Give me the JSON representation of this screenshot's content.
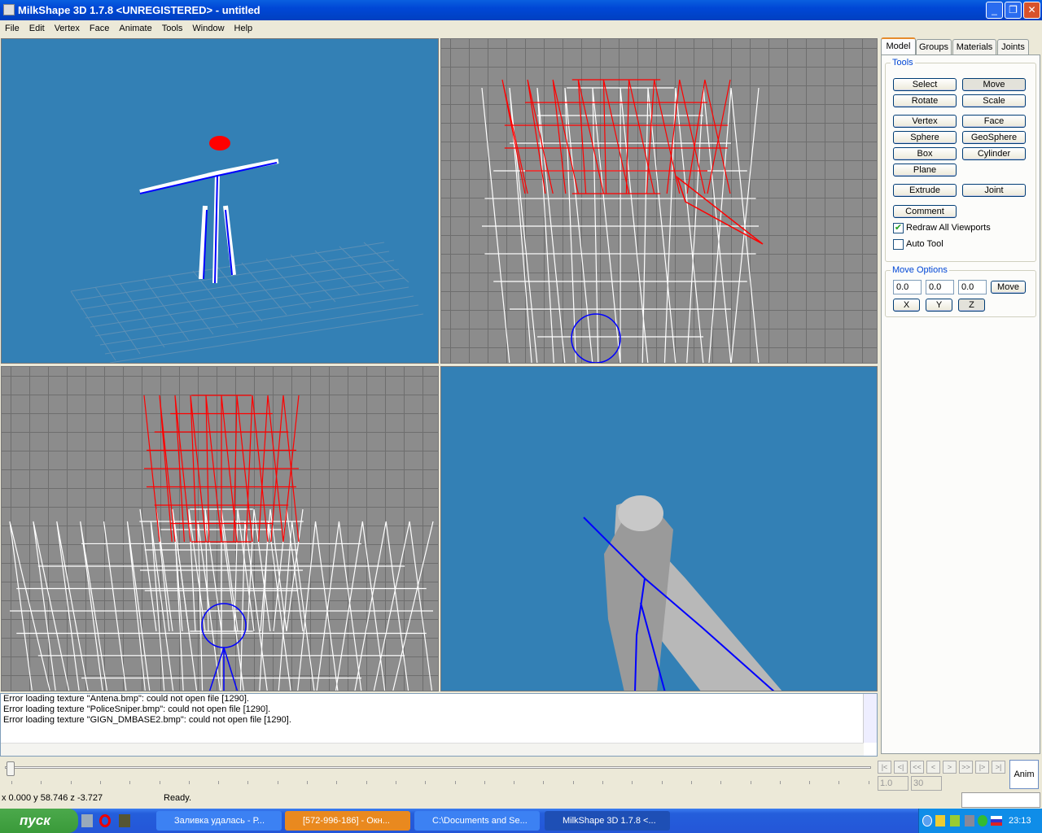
{
  "window": {
    "title": "MilkShape 3D 1.7.8 <UNREGISTERED> - untitled",
    "min": "_",
    "max": "❐",
    "close": "✕"
  },
  "menu": [
    "File",
    "Edit",
    "Vertex",
    "Face",
    "Animate",
    "Tools",
    "Window",
    "Help"
  ],
  "colors": {
    "viewport_bg": "#3380b5",
    "grid_bg": "#8c8c8c",
    "selection": "#ff0000",
    "joints": "#0000ff",
    "wire": "#ffffff"
  },
  "panel": {
    "tabs": [
      "Model",
      "Groups",
      "Materials",
      "Joints"
    ],
    "active_tab": "Model",
    "tools_label": "Tools",
    "tools": [
      "Select",
      "Move",
      "Rotate",
      "Scale",
      "Vertex",
      "Face",
      "Sphere",
      "GeoSphere",
      "Box",
      "Cylinder",
      "Plane",
      "Extrude",
      "Joint"
    ],
    "active_tool": "Move",
    "comment": "Comment",
    "redraw_all": {
      "label": "Redraw All Viewports",
      "checked": true
    },
    "auto_tool": {
      "label": "Auto Tool",
      "checked": false
    },
    "move_options_label": "Move Options",
    "move_values": [
      "0.0",
      "0.0",
      "0.0"
    ],
    "move_button": "Move",
    "axes": [
      "X",
      "Y",
      "Z"
    ]
  },
  "log": [
    "Error loading texture \"Antena.bmp\": could not open file [1290].",
    "Error loading texture \"PoliceSniper.bmp\": could not open file [1290].",
    "Error loading texture \"GIGN_DMBASE2.bmp\": could not open file [1290]."
  ],
  "animation": {
    "buttons": [
      "|<",
      "<|",
      "<<",
      "<",
      ">",
      ">>",
      "|>",
      ">|"
    ],
    "start_frame": "1.0",
    "end_frame": "30",
    "anim": "Anim"
  },
  "status": {
    "coords": "x 0.000 y 58.746 z -3.727",
    "message": "Ready."
  },
  "taskbar": {
    "start": "пуск",
    "tasks": [
      "Заливка удалась - Р...",
      "[572-996-186] - Окн...",
      "C:\\Documents and Se...",
      "MilkShape 3D 1.7.8 <..."
    ],
    "clock": "23:13"
  }
}
